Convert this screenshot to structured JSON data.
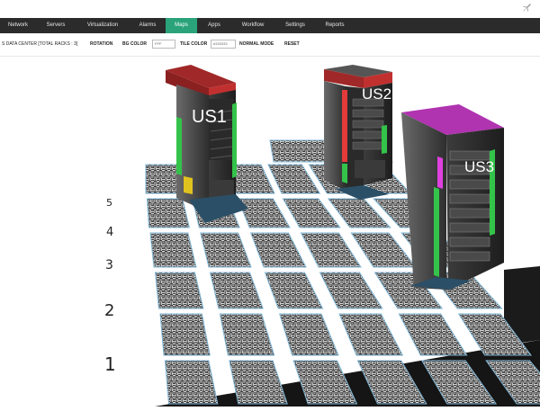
{
  "nav": {
    "items": [
      "Network",
      "Servers",
      "Virtualization",
      "Alarms",
      "Maps",
      "Apps",
      "Workflow",
      "Settings",
      "Reports"
    ],
    "active": "Maps"
  },
  "toolbar": {
    "datacenter": "S DATA CENTER [TOTAL RACKS : 3]",
    "rotation": "ROTATION",
    "bg_color_label": "BG COLOR",
    "bg_color_value": "FFF",
    "tile_color_label": "TILE COLOR",
    "tile_color_value": "#333333",
    "normal_mode": "NORMAL MODE",
    "reset": "RESET"
  },
  "row_labels": [
    "5",
    "4",
    "3",
    "2",
    "1"
  ],
  "racks": [
    {
      "label": "US1",
      "top_color": "#c0302f"
    },
    {
      "label": "US2",
      "top_color": "#c0302f"
    },
    {
      "label": "US3",
      "top_color": "#b033b0"
    }
  ],
  "colors": {
    "accent": "#2aa37a",
    "navbar": "#2b2b2b",
    "status_green": "#34c34a",
    "status_yellow": "#e0c21e"
  }
}
